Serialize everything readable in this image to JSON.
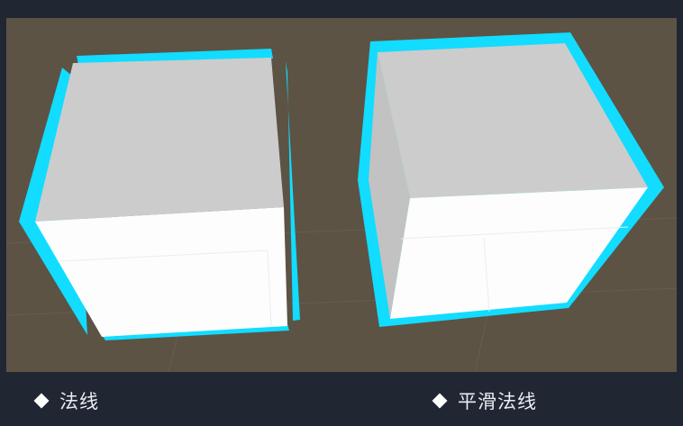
{
  "scene": {
    "background_color": "#5c5344",
    "outline_color": "#12dcff",
    "cube_top_color": "#cccccc",
    "cube_front_color": "#fdfdfd",
    "cube_side_color": "#c2c2c2"
  },
  "captions": [
    {
      "label": "法线"
    },
    {
      "label": "平滑法线"
    }
  ]
}
